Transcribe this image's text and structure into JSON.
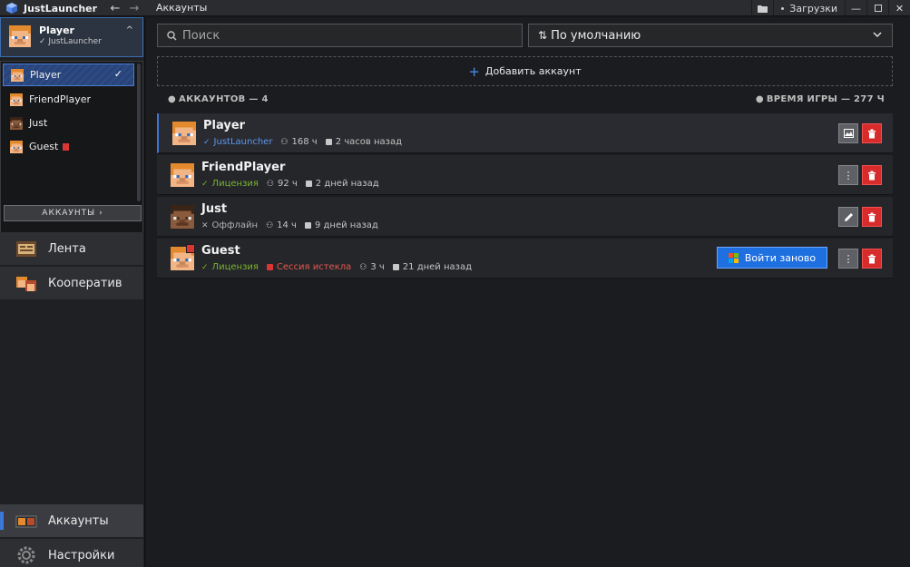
{
  "titlebar": {
    "app_name": "JustLauncher",
    "page_title": "Аккаунты",
    "downloads_label": "Загрузки"
  },
  "sidebar": {
    "profile": {
      "name": "Player",
      "source": "JustLauncher"
    },
    "accounts": [
      {
        "name": "Player",
        "selected": true,
        "warning": false
      },
      {
        "name": "FriendPlayer",
        "selected": false,
        "warning": false
      },
      {
        "name": "Just",
        "selected": false,
        "warning": false
      },
      {
        "name": "Guest",
        "selected": false,
        "warning": true
      }
    ],
    "accounts_button": "АККАУНТЫ",
    "nav": [
      {
        "label": "Лента",
        "icon": "news-feed-icon"
      },
      {
        "label": "Кооператив",
        "icon": "coop-icon"
      }
    ],
    "bottom_nav": [
      {
        "label": "Аккаунты",
        "icon": "accounts-icon",
        "active": true
      },
      {
        "label": "Настройки",
        "icon": "settings-gear-icon",
        "active": false
      }
    ]
  },
  "main": {
    "search_placeholder": "Поиск",
    "sort_value": "По умолчанию",
    "add_account": "Добавить аккаунт",
    "accounts_count": "АККАУНТОВ — 4",
    "play_time_total": "ВРЕМЯ ИГРЫ — 277 Ч",
    "relogin_label": "Войти заново",
    "rows": [
      {
        "name": "Player",
        "type": "JustLauncher",
        "hours": "168 ч",
        "last_seen": "2 часов назад"
      },
      {
        "name": "FriendPlayer",
        "type": "Лицензия",
        "hours": "92 ч",
        "last_seen": "2 дней назад"
      },
      {
        "name": "Just",
        "type": "Оффлайн",
        "hours": "14 ч",
        "last_seen": "9 дней назад"
      },
      {
        "name": "Guest",
        "type": "Лицензия",
        "session": "Сессия истекла",
        "hours": "3 ч",
        "last_seen": "21 дней назад"
      }
    ]
  },
  "colors": {
    "accent": "#3d78d8",
    "danger": "#d82c2c",
    "license": "#79b32e",
    "launcher": "#5d97f0"
  }
}
